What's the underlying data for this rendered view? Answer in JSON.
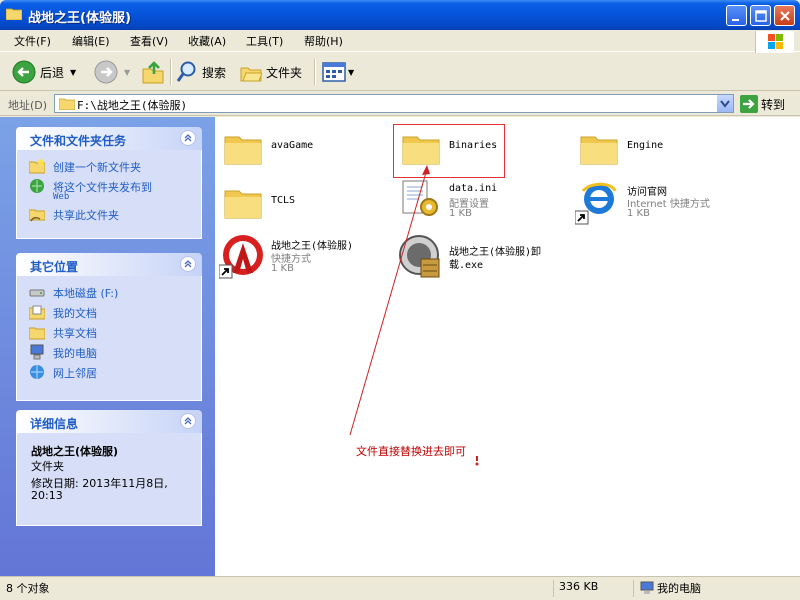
{
  "window": {
    "title": "战地之王(体验服)",
    "buttons": [
      "minimize-button",
      "maximize-button",
      "close-button"
    ]
  },
  "menu": [
    "文件(F)",
    "编辑(E)",
    "查看(V)",
    "收藏(A)",
    "工具(T)",
    "帮助(H)"
  ],
  "toolbar": {
    "back_label": "后退",
    "search_label": "搜索",
    "folders_label": "文件夹"
  },
  "address": {
    "label": "地址(D)",
    "value": "F:\\战地之王(体验服)",
    "go_label": "转到"
  },
  "sidebar": {
    "tasks": {
      "title": "文件和文件夹任务",
      "items": [
        {
          "label": "创建一个新文件夹",
          "icon": "new-folder-icon"
        },
        {
          "label": "将这个文件夹发布到",
          "label2": "Web",
          "icon": "publish-web-icon"
        },
        {
          "label": "共享此文件夹",
          "icon": "share-folder-icon"
        }
      ]
    },
    "places": {
      "title": "其它位置",
      "items": [
        {
          "label": "本地磁盘 (F:)",
          "icon": "drive-icon"
        },
        {
          "label": "我的文档",
          "icon": "my-documents-icon"
        },
        {
          "label": "共享文档",
          "icon": "shared-documents-icon"
        },
        {
          "label": "我的电脑",
          "icon": "my-computer-icon"
        },
        {
          "label": "网上邻居",
          "icon": "network-icon"
        }
      ]
    },
    "details": {
      "title": "详细信息",
      "name": "战地之王(体验服)",
      "type": "文件夹",
      "modified": "修改日期: 2013年11月8日,",
      "modified2": "20:13"
    }
  },
  "files": [
    {
      "name": "avaGame",
      "type": "folder"
    },
    {
      "name": "Binaries",
      "type": "folder",
      "highlighted": true
    },
    {
      "name": "Engine",
      "type": "folder"
    },
    {
      "name": "TCLS",
      "type": "folder"
    },
    {
      "name": "data.ini",
      "sub1": "配置设置",
      "sub2": "1 KB",
      "type": "config"
    },
    {
      "name": "访问官网",
      "sub1": "Internet 快捷方式",
      "sub2": "1 KB",
      "type": "ie-shortcut"
    },
    {
      "name": "战地之王(体验服)",
      "sub1": "快捷方式",
      "sub2": "1 KB",
      "type": "app-shortcut"
    },
    {
      "name": "战地之王(体验服)卸",
      "name2": "载.exe",
      "type": "uninstaller"
    }
  ],
  "annotation": "文件直接替换进去即可",
  "status": {
    "count": "8 个对象",
    "size": "336 KB",
    "location": "我的电脑"
  },
  "colors": {
    "title_bar": "#0653d9",
    "sidebar_bg": "#6f8cdd",
    "task_text": "#215dc6",
    "annotation": "#c00000",
    "highlight_box": "#e83030"
  }
}
